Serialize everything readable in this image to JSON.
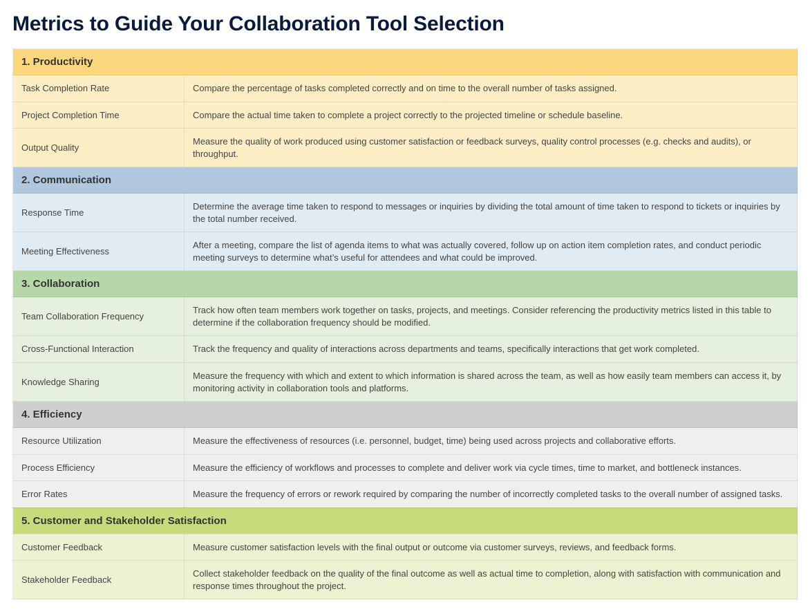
{
  "title": "Metrics to Guide Your Collaboration Tool Selection",
  "categories": [
    {
      "header": "1. Productivity",
      "hClass": "c1-h",
      "rClass": "c1-r",
      "metrics": [
        {
          "name": "Task Completion Rate",
          "desc": "Compare the percentage of tasks completed correctly and on time to the overall number of tasks assigned."
        },
        {
          "name": "Project Completion Time",
          "desc": "Compare the actual time taken to complete a project correctly to the projected timeline or schedule baseline."
        },
        {
          "name": "Output Quality",
          "desc": "Measure the quality of work produced using customer satisfaction or feedback surveys, quality control processes (e.g. checks and audits), or throughput."
        }
      ]
    },
    {
      "header": "2. Communication",
      "hClass": "c2-h",
      "rClass": "c2-r",
      "metrics": [
        {
          "name": "Response Time",
          "desc": "Determine the average time taken to respond to messages or inquiries by dividing the total amount of time taken to respond to tickets or inquiries by the total number received."
        },
        {
          "name": "Meeting Effectiveness",
          "desc": "After a meeting, compare the list of agenda items to what was actually covered, follow up on action item completion rates, and conduct periodic meeting surveys to determine what’s useful for attendees and what could be improved."
        }
      ]
    },
    {
      "header": "3. Collaboration",
      "hClass": "c3-h",
      "rClass": "c3-r",
      "metrics": [
        {
          "name": "Team Collaboration Frequency",
          "desc": "Track how often team members work together on tasks, projects, and meetings. Consider referencing the productivity metrics listed in this table to determine if the collaboration frequency should be modified."
        },
        {
          "name": "Cross-Functional Interaction",
          "desc": "Track the frequency and quality of interactions across departments and teams, specifically interactions that get work completed."
        },
        {
          "name": "Knowledge Sharing",
          "desc": "Measure the frequency with which and extent to which information is shared across the team, as well as how easily team members can access it, by monitoring activity in collaboration tools and platforms."
        }
      ]
    },
    {
      "header": "4. Efficiency",
      "hClass": "c4-h",
      "rClass": "c4-r",
      "metrics": [
        {
          "name": "Resource Utilization",
          "desc": "Measure the effectiveness of resources (i.e. personnel, budget, time) being used across projects and collaborative efforts."
        },
        {
          "name": "Process Efficiency",
          "desc": "Measure the efficiency of workflows and processes to complete and deliver work via cycle times, time to market, and bottleneck instances."
        },
        {
          "name": "Error Rates",
          "desc": "Measure the frequency of errors or rework required by comparing the number of incorrectly completed tasks to the overall number of assigned tasks."
        }
      ]
    },
    {
      "header": "5. Customer and Stakeholder Satisfaction",
      "hClass": "c5-h",
      "rClass": "c5-r",
      "metrics": [
        {
          "name": "Customer Feedback",
          "desc": "Measure customer satisfaction levels with the final output or outcome via customer surveys, reviews, and feedback forms."
        },
        {
          "name": "Stakeholder Feedback",
          "desc": "Collect stakeholder feedback on the quality of the final outcome as well as actual time to completion, along with satisfaction with communication and response times throughout the project."
        }
      ]
    }
  ]
}
